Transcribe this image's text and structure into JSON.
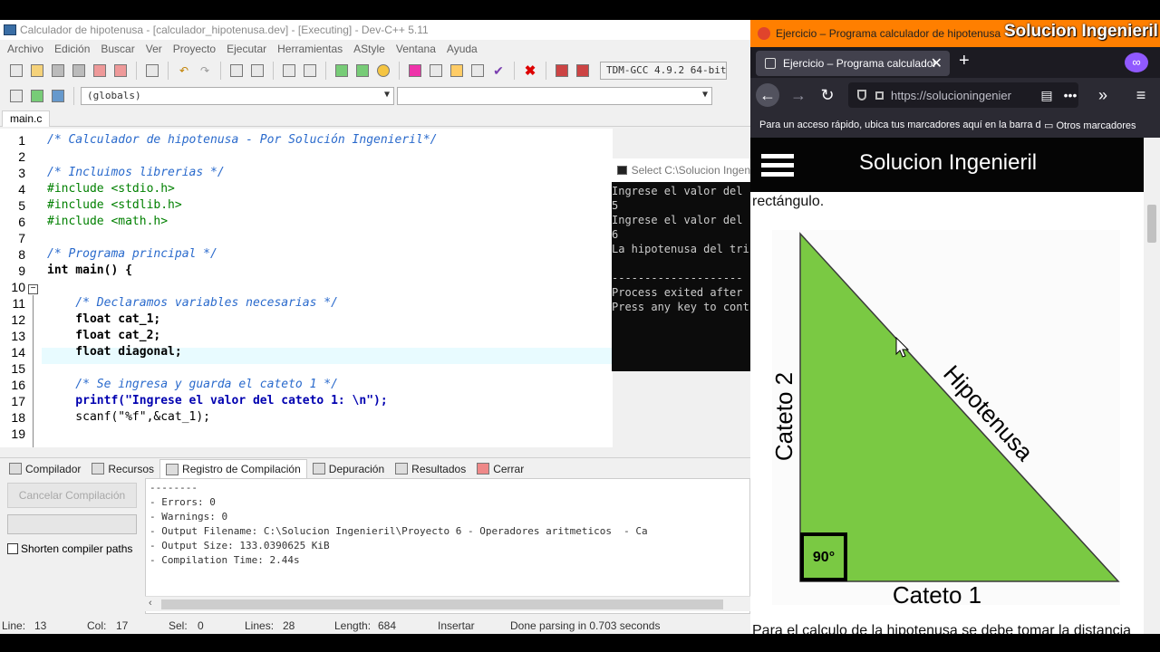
{
  "devcpp": {
    "title": "Calculador de hipotenusa - [calculador_hipotenusa.dev] - [Executing] - Dev-C++ 5.11",
    "menu": [
      "Archivo",
      "Edición",
      "Buscar",
      "Ver",
      "Proyecto",
      "Ejecutar",
      "Herramientas",
      "AStyle",
      "Ventana",
      "Ayuda"
    ],
    "compiler": "TDM-GCC 4.9.2 64-bit",
    "scope_combo": "(globals)",
    "file_tab": "main.c",
    "lines": [
      {
        "n": "1",
        "text": "/* Calculador de hipotenusa - Por Solución Ingenieril*/"
      },
      {
        "n": "2",
        "text": ""
      },
      {
        "n": "3",
        "text": "/* Incluimos librerias */"
      },
      {
        "n": "4",
        "text": "#include <stdio.h>"
      },
      {
        "n": "5",
        "text": "#include <stdlib.h>"
      },
      {
        "n": "6",
        "text": "#include <math.h>"
      },
      {
        "n": "7",
        "text": ""
      },
      {
        "n": "8",
        "text": "/* Programa principal */"
      },
      {
        "n": "9",
        "text": "int main() {"
      },
      {
        "n": "10",
        "text": ""
      },
      {
        "n": "11",
        "text": "    /* Declaramos variables necesarias */"
      },
      {
        "n": "12",
        "text": "    float cat_1;"
      },
      {
        "n": "13",
        "text": "    float cat_2;"
      },
      {
        "n": "14",
        "text": "    float diagonal;"
      },
      {
        "n": "15",
        "text": ""
      },
      {
        "n": "16",
        "text": "    /* Se ingresa y guarda el cateto 1 */"
      },
      {
        "n": "17",
        "text": "    printf(\"Ingrese el valor del cateto 1: \\n\");"
      },
      {
        "n": "18",
        "text": "    scanf(\"%f\",&cat_1);"
      },
      {
        "n": "19",
        "text": ""
      }
    ],
    "bottom_tabs": [
      "Compilador",
      "Recursos",
      "Registro de Compilación",
      "Depuración",
      "Resultados",
      "Cerrar"
    ],
    "cancel_button": "Cancelar Compilación",
    "shorten_label": "Shorten compiler paths",
    "log": [
      "--------",
      "- Errors: 0",
      "- Warnings: 0",
      "- Output Filename: C:\\Solucion Ingenieril\\Proyecto 6 - Operadores aritmeticos  - Ca",
      "- Output Size: 133.0390625 KiB",
      "- Compilation Time: 2.44s"
    ],
    "status": {
      "line_label": "Line:",
      "line": "13",
      "col_label": "Col:",
      "col": "17",
      "sel_label": "Sel:",
      "sel": "0",
      "lines_label": "Lines:",
      "lines": "28",
      "length_label": "Length:",
      "length": "684",
      "mode": "Insertar",
      "parse": "Done parsing in 0.703 seconds"
    }
  },
  "console": {
    "title": "Select C:\\Solucion Ingen",
    "lines": [
      "Ingrese el valor del",
      "5",
      "Ingrese el valor del",
      "6",
      "La hipotenusa del tri",
      "",
      "--------------------",
      "Process exited after",
      "Press any key to cont"
    ]
  },
  "browser": {
    "window_title": "Ejercicio – Programa calculador de hipotenusa",
    "brand_overlay": "Solucion Ingenieril",
    "tab_title": "Ejercicio – Programa calculador",
    "url": "https://solucioningenier",
    "bookmarks_hint": "Para un acceso rápido, ubica tus marcadores aquí en la barra de marcadores.",
    "other_bookmarks": "Otros marcadores",
    "site_logo": "Solucion Ingenieril",
    "intro": "rectángulo.",
    "figure": {
      "hypotenuse": "Hipotenusa",
      "cateto1": "Cateto 1",
      "cateto2": "Cateto 2",
      "angle": "90°",
      "fill": "#7ac943"
    },
    "bottom_text": "Para el calculo de la hipotenusa se debe tomar la distancia"
  }
}
